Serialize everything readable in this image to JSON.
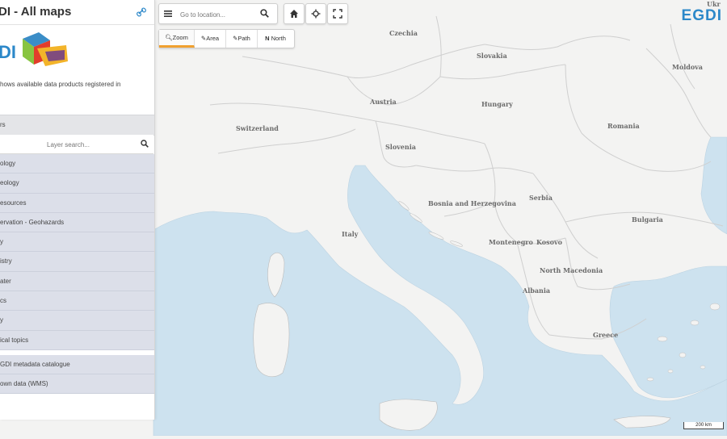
{
  "sidebar": {
    "title": "DI - All maps",
    "logo_text": "DI",
    "description": "hows available data products registered in",
    "section_label": "rs",
    "search_placeholder": "Layer search...",
    "layers": [
      {
        "label": "ology"
      },
      {
        "label": "eology"
      },
      {
        "label": "esources"
      },
      {
        "label": "ervation - Geohazards"
      },
      {
        "label": "y"
      },
      {
        "label": "istry"
      },
      {
        "label": "ater"
      },
      {
        "label": "cs"
      },
      {
        "label": "y"
      },
      {
        "label": "ical topics"
      }
    ],
    "extra_items": [
      {
        "label": "GDI metadata catalogue"
      },
      {
        "label": "own data (WMS)"
      }
    ]
  },
  "toolbar": {
    "location_placeholder": "Go to location...",
    "home_icon": "home-icon",
    "locate_icon": "crosshair-icon",
    "fullscreen_icon": "fullscreen-icon",
    "tools": [
      {
        "label": "Zoom",
        "icon": "magnifier-icon",
        "active": true
      },
      {
        "label": "Area",
        "icon": "pencil-icon",
        "active": false
      },
      {
        "label": "Path",
        "icon": "pencil-icon",
        "active": false
      },
      {
        "label": "North",
        "icon": "north-icon",
        "active": false
      }
    ]
  },
  "brand": "EGDI",
  "map": {
    "labels": [
      "Czechia",
      "Slovakia",
      "Moldova",
      "Austria",
      "Hungary",
      "Switzerland",
      "Romania",
      "Slovenia",
      "Bosnia and Herzegovina",
      "Serbia",
      "Bulgaria",
      "Italy",
      "Montenegro",
      "Kosovo",
      "North Macedonia",
      "Albania",
      "Greece",
      "Ukr"
    ],
    "scale": "200 km",
    "colors": {
      "land": "#f3f3f2",
      "sea": "#cde2ef",
      "borders": "#cfcfcf",
      "brand": "#2c88c9",
      "active_tool": "#f0a030"
    }
  }
}
